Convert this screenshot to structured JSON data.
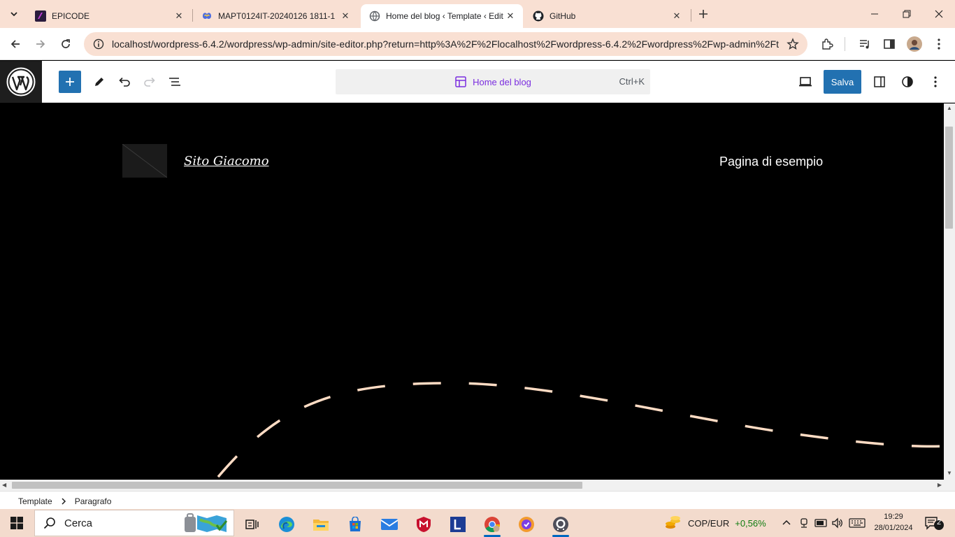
{
  "browser": {
    "tabs": [
      {
        "title": "EPICODE",
        "favicon": "epicode-icon",
        "active": false
      },
      {
        "title": "MAPT0124IT-20240126 1811-1",
        "favicon": "teams-icon",
        "active": false
      },
      {
        "title": "Home del blog ‹ Template ‹ Edit",
        "favicon": "wordpress-tab-icon",
        "active": true
      },
      {
        "title": "GitHub",
        "favicon": "github-icon",
        "active": false
      }
    ],
    "url": "localhost/wordpress-6.4.2/wordpress/wp-admin/site-editor.php?return=http%3A%2F%2Flocalhost%2Fwordpress-6.4.2%2Fwordpress%2Fwp-admin%2Fth...",
    "colors": {
      "tabstrip": "#f9e0d3",
      "omnibox": "#f9e0d3"
    }
  },
  "editor": {
    "command_title": "Home del blog",
    "command_shortcut": "Ctrl+K",
    "save_label": "Salva",
    "accent": "#2271b1"
  },
  "canvas": {
    "site_title": "Sito Giacomo",
    "nav_item": "Pagina di esempio",
    "background": "#000000",
    "decoration_color": "#ffdcc4"
  },
  "footer": {
    "breadcrumb": [
      "Template",
      "Paragrafo"
    ]
  },
  "taskbar": {
    "search_label": "Cerca",
    "ticker_label": "COP/EUR",
    "ticker_change": "+0,56%",
    "time": "19:29",
    "date": "28/01/2024",
    "notification_count": "2"
  }
}
